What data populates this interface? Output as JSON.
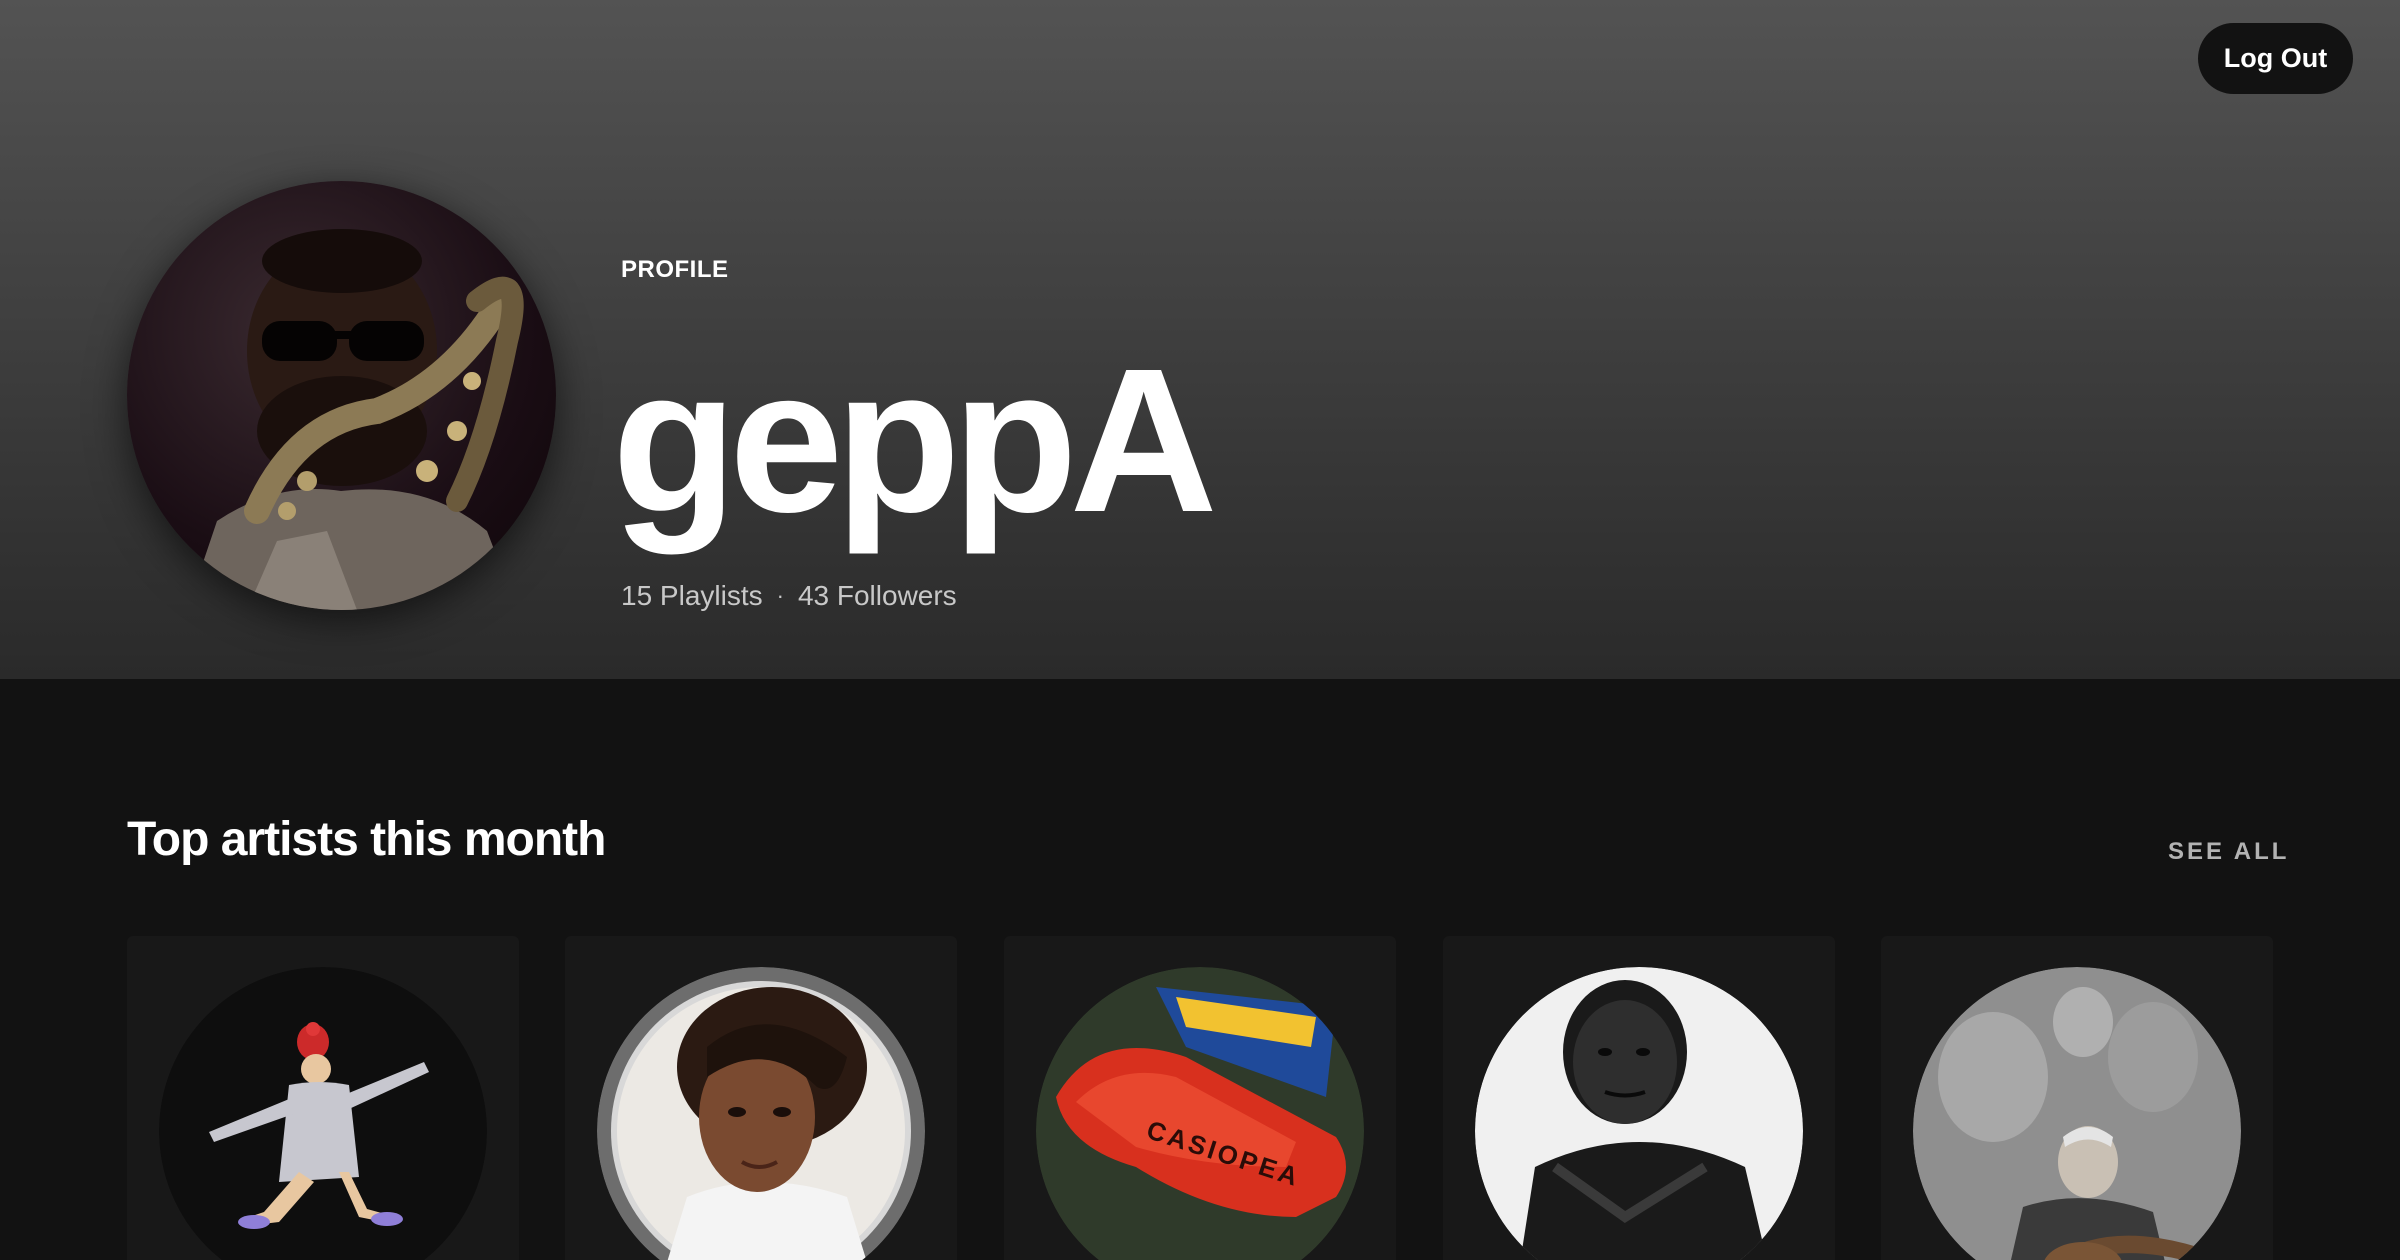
{
  "header": {
    "logout_label": "Log Out",
    "profile_label": "PROFILE",
    "user_name": "geppA",
    "playlists": "15 Playlists",
    "separator": "·",
    "followers": "43 Followers"
  },
  "top_artists": {
    "title": "Top artists this month",
    "see_all_label": "SEE ALL",
    "items": [
      {
        "image": "yoga-figure-artwork"
      },
      {
        "image": "portrait-curly-hair"
      },
      {
        "image": "red-race-car-casiopea"
      },
      {
        "image": "bw-portrait"
      },
      {
        "image": "guitarist-sketch"
      }
    ]
  },
  "casiopea_text": "CASIOPEA",
  "colors": {
    "background": "#121212",
    "card": "#181818",
    "header_top": "#535353",
    "muted_text": "#b3b3b3"
  }
}
